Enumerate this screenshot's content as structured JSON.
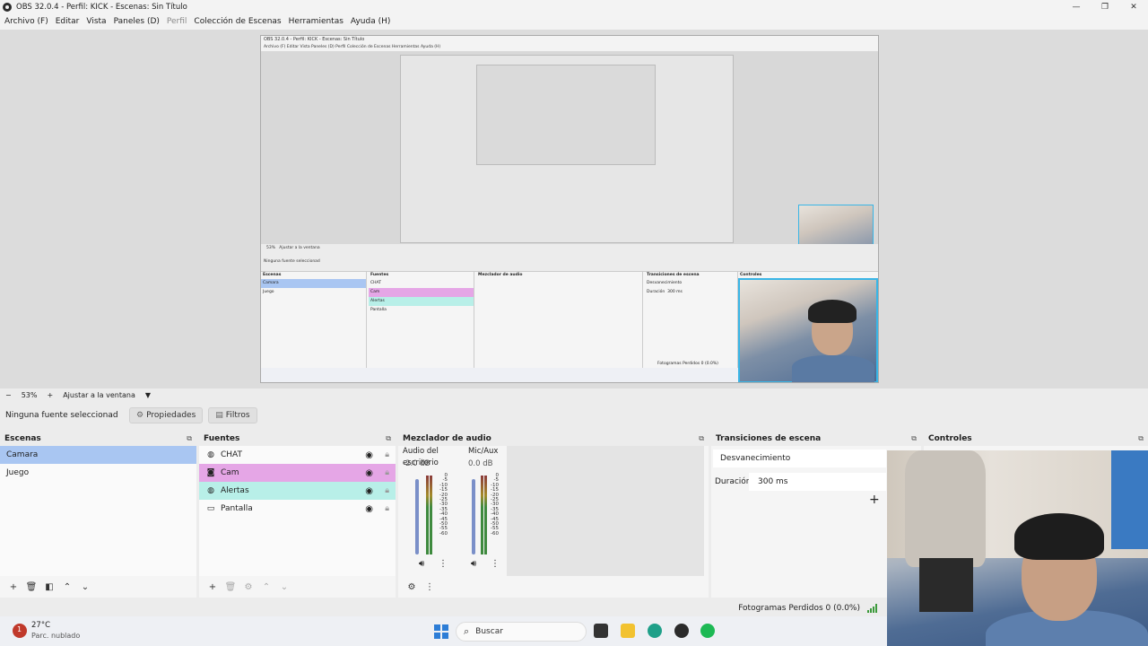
{
  "window": {
    "title": "OBS 32.0.4 - Perfil: KICK - Escenas: Sin Título",
    "controls": [
      "—",
      "❐",
      "✕"
    ]
  },
  "menu": [
    {
      "label": "Archivo (F)",
      "disabled": false
    },
    {
      "label": "Editar",
      "disabled": false
    },
    {
      "label": "Vista",
      "disabled": false
    },
    {
      "label": "Paneles (D)",
      "disabled": false
    },
    {
      "label": "Perfil",
      "disabled": true
    },
    {
      "label": "Colección de Escenas",
      "disabled": false
    },
    {
      "label": "Herramientas",
      "disabled": false
    },
    {
      "label": "Ayuda (H)",
      "disabled": false
    }
  ],
  "zoom": {
    "minus": "−",
    "value": "53%",
    "plus": "+",
    "fit": "Ajustar a la ventana",
    "dropdown": "▼"
  },
  "source_toolbar": {
    "no_source": "Ninguna fuente seleccionad",
    "properties": "Propiedades",
    "filters": "Filtros"
  },
  "scenes": {
    "title": "Escenas",
    "items": [
      "Camara",
      "Juego"
    ]
  },
  "sources": {
    "title": "Fuentes",
    "items": [
      {
        "label": "CHAT",
        "icon": "globe-icon"
      },
      {
        "label": "Cam",
        "icon": "camera-icon"
      },
      {
        "label": "Alertas",
        "icon": "globe-icon"
      },
      {
        "label": "Pantalla",
        "icon": "monitor-icon"
      }
    ]
  },
  "mixer": {
    "title": "Mezclador de audio",
    "channels": [
      {
        "name": "Audio del escritorio",
        "db": "-2.0 dB"
      },
      {
        "name": "Mic/Aux",
        "db": "0.0 dB"
      }
    ],
    "scale": [
      "0",
      "-5",
      "-10",
      "-15",
      "-20",
      "-25",
      "-30",
      "-35",
      "-40",
      "-45",
      "-50",
      "-55",
      "-60"
    ]
  },
  "transitions": {
    "title": "Transiciones de escena",
    "selected": "Desvanecimiento",
    "duration_label": "Duración",
    "duration_value": "300 ms",
    "add": "+"
  },
  "controls": {
    "title": "Controles"
  },
  "status": {
    "frames": "Fotogramas Perdidos 0 (0.0%)"
  },
  "taskbar": {
    "temp": "27°C",
    "condition": "Parc. nublado",
    "search": "Buscar"
  },
  "canvas_preview": {
    "title": "OBS 32.0.4 - Perfil: KICK - Escenas: Sin Título",
    "menu": "Archivo (F)   Editar   Vista   Paneles (D)   Perfil   Colección de Escenas   Herramientas   Ayuda (H)",
    "no_source": "Ninguna fuente seleccionad",
    "scenes_hdr": "Escenas",
    "scene1": "Camara",
    "scene2": "Juego",
    "sources_hdr": "Fuentes",
    "src1": "CHAT",
    "src2": "Cam",
    "src3": "Alertas",
    "src4": "Pantalla",
    "mixer_hdr": "Mezclador de audio",
    "trans_hdr": "Transiciones de escena",
    "trans_sel": "Desvanecimiento",
    "trans_dur": "Duración",
    "trans_dur_val": "300 ms",
    "controls_hdr": "Controles",
    "frames": "Fotogramas Perdidos 0 (0.0%)"
  }
}
